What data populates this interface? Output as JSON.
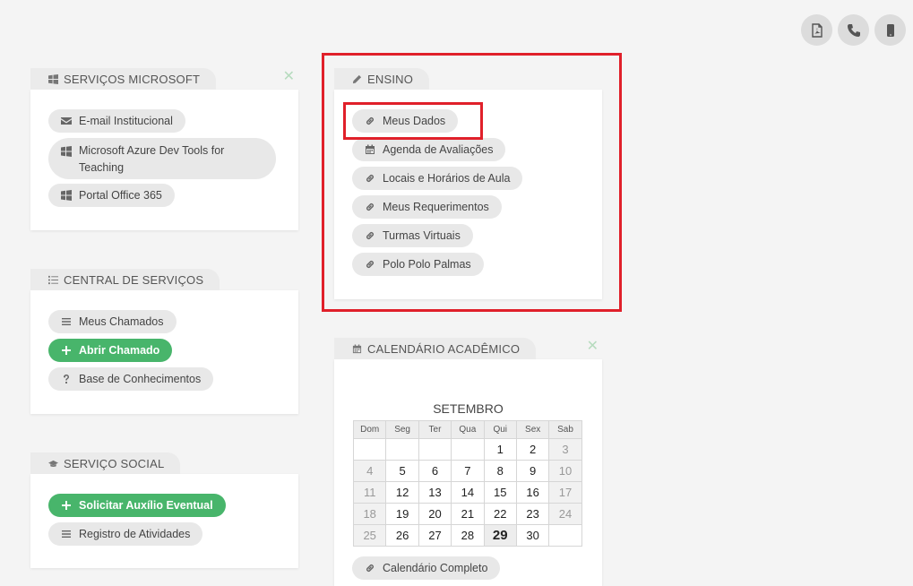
{
  "top_icons": [
    {
      "name": "pdf-icon"
    },
    {
      "name": "phone-icon"
    },
    {
      "name": "mobile-icon"
    }
  ],
  "microsoft": {
    "title": "SERVIÇOS MICROSOFT",
    "close": "✕",
    "items": [
      "E-mail Institucional",
      "Microsoft Azure Dev Tools for Teaching",
      "Portal Office 365"
    ]
  },
  "central": {
    "title": "CENTRAL DE SERVIÇOS",
    "items": [
      "Meus Chamados",
      "Abrir Chamado",
      "Base de Conhecimentos"
    ]
  },
  "social": {
    "title": "SERVIÇO SOCIAL",
    "items": [
      "Solicitar Auxílio Eventual",
      "Registro de Atividades"
    ]
  },
  "ensino": {
    "title": "ENSINO",
    "items": [
      "Meus Dados",
      "Agenda de Avaliações",
      "Locais e Horários de Aula",
      "Meus Requerimentos",
      "Turmas Virtuais",
      "Polo Polo Palmas"
    ]
  },
  "calendar": {
    "title": "CALENDÁRIO ACADÊMICO",
    "close": "✕",
    "month": "SETEMBRO",
    "weekdays": [
      "Dom",
      "Seg",
      "Ter",
      "Qua",
      "Qui",
      "Sex",
      "Sab"
    ],
    "weeks": [
      [
        "",
        "",
        "",
        "",
        "1",
        "2",
        "3"
      ],
      [
        "4",
        "5",
        "6",
        "7",
        "8",
        "9",
        "10"
      ],
      [
        "11",
        "12",
        "13",
        "14",
        "15",
        "16",
        "17"
      ],
      [
        "18",
        "19",
        "20",
        "21",
        "22",
        "23",
        "24"
      ],
      [
        "25",
        "26",
        "27",
        "28",
        "29",
        "30",
        ""
      ]
    ],
    "today": "29",
    "full_link": "Calendário Completo"
  },
  "colors": {
    "accent_green": "#48b56b",
    "highlight_red": "#e0202a"
  }
}
